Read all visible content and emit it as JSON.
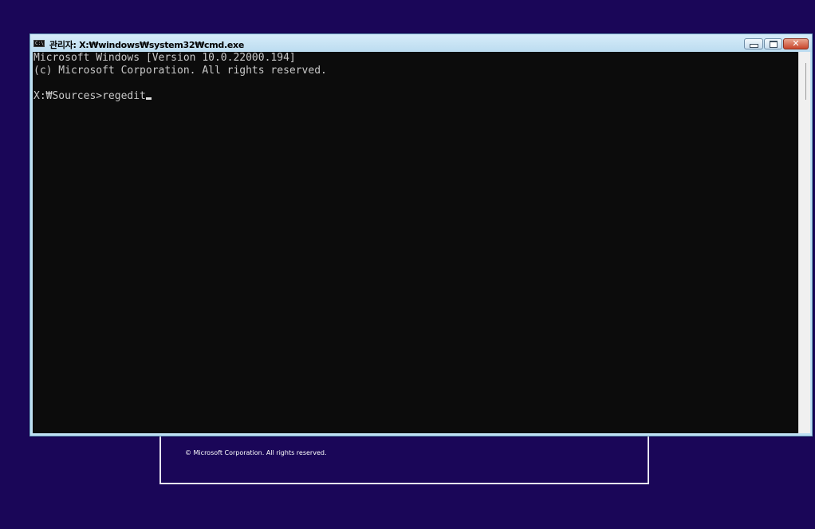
{
  "setup": {
    "copyright": "© Microsoft Corporation. All rights reserved."
  },
  "window": {
    "title": "관리자: X:₩windows₩system32₩cmd.exe",
    "icon": "console-icon",
    "icon_label": "C:\\",
    "close_glyph": "✕"
  },
  "console": {
    "lines": [
      "Microsoft Windows [Version 10.0.22000.194]",
      "(c) Microsoft Corporation. All rights reserved.",
      "",
      "X:₩Sources>regedit"
    ]
  },
  "colors": {
    "desktop": "#1a0658",
    "console_bg": "#0c0c0c",
    "console_text": "#c8c8c8",
    "titlebar": "#bfe0f3",
    "close_button": "#c8452b"
  }
}
